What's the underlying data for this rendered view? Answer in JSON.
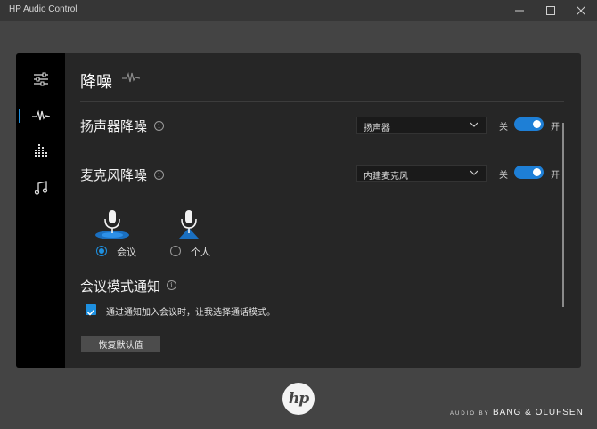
{
  "window": {
    "title": "HP Audio Control",
    "controls": {
      "minimize": "—",
      "maximize": "☐",
      "close": "✕"
    }
  },
  "sidebar": {
    "items": [
      {
        "icon": "sliders-icon",
        "selected": false
      },
      {
        "icon": "waveform-icon",
        "selected": true
      },
      {
        "icon": "equalizer-icon",
        "selected": false
      },
      {
        "icon": "music-note-icon",
        "selected": false
      }
    ]
  },
  "page": {
    "title": "降噪",
    "title_icon": "waveform-icon"
  },
  "speaker": {
    "label": "扬声器降噪",
    "info": "i",
    "device": "扬声器",
    "toggle_off_label": "关",
    "toggle_on_label": "开",
    "enabled": true
  },
  "mic": {
    "label": "麦克风降噪",
    "info": "i",
    "device": "内建麦克风",
    "toggle_off_label": "关",
    "toggle_on_label": "开",
    "enabled": true,
    "modes": [
      {
        "label": "会议",
        "checked": true,
        "icon": "conference-mic-icon"
      },
      {
        "label": "个人",
        "checked": false,
        "icon": "personal-mic-icon"
      }
    ]
  },
  "meeting_notice": {
    "title": "会议模式通知",
    "info": "i",
    "checkbox_label": "通过通知加入会议时，让我选择通话模式。",
    "checked": true
  },
  "reset_button": "恢复默认值",
  "footer": {
    "logo_text": "hp",
    "audio_by": "AUDIO BY",
    "brand": "BANG & OLUFSEN"
  },
  "colors": {
    "accent": "#1e7fd6",
    "panel": "#262626",
    "rail": "#000000",
    "background": "#444444"
  }
}
